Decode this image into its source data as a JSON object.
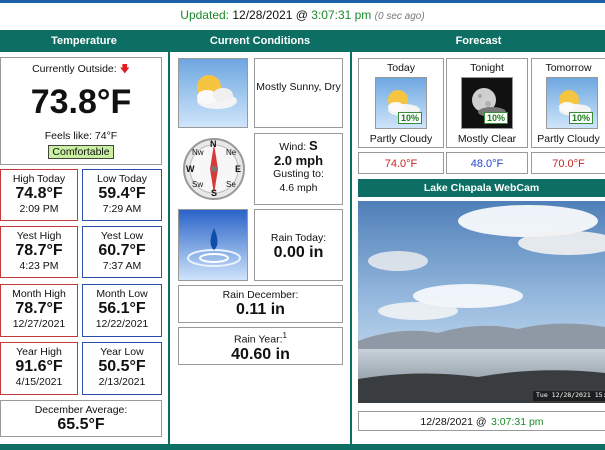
{
  "header": {
    "updated_label": "Updated:",
    "updated_date": "12/28/2021 @",
    "updated_time": "3:07:31 pm",
    "updated_ago": "(0 sec ago)"
  },
  "columns": {
    "temperature": "Temperature",
    "conditions": "Current Conditions",
    "forecast": "Forecast"
  },
  "temperature": {
    "current_label": "Currently Outside:",
    "trend_icon": "down-arrow-icon",
    "current": "73.8°F",
    "feels_like": "Feels like: 74°F",
    "comfort": "Comfortable",
    "high_today_label": "High Today",
    "high_today": "74.8°F",
    "high_today_time": "2:09 PM",
    "low_today_label": "Low Today",
    "low_today": "59.4°F",
    "low_today_time": "7:29 AM",
    "yest_high_label": "Yest High",
    "yest_high": "78.7°F",
    "yest_high_time": "4:23 PM",
    "yest_low_label": "Yest Low",
    "yest_low": "60.7°F",
    "yest_low_time": "7:37 AM",
    "month_high_label": "Month High",
    "month_high": "78.7°F",
    "month_high_date": "12/27/2021",
    "month_low_label": "Month Low",
    "month_low": "56.1°F",
    "month_low_date": "12/22/2021",
    "year_high_label": "Year High",
    "year_high": "91.6°F",
    "year_high_date": "4/15/2021",
    "year_low_label": "Year Low",
    "year_low": "50.5°F",
    "year_low_date": "2/13/2021",
    "dec_avg_label": "December Average:",
    "dec_avg": "65.5°F"
  },
  "conditions": {
    "sky": "Mostly Sunny, Dry",
    "wind_label": "Wind:",
    "wind_dir": "S",
    "wind_speed": "2.0 mph",
    "gust_label": "Gusting to:",
    "gust": "4.6 mph",
    "compass_n": "N",
    "compass_nw": "Nw",
    "compass_ne": "Ne",
    "compass_w": "W",
    "compass_e": "E",
    "compass_sw": "Sw",
    "compass_se": "Se",
    "compass_s": "S",
    "rain_today_label": "Rain Today:",
    "rain_today": "0.00 in",
    "rain_month_label": "Rain December:",
    "rain_month": "0.11 in",
    "rain_year_label": "Rain Year:",
    "rain_year_sup": "1",
    "rain_year": "40.60 in"
  },
  "forecast": {
    "items": [
      {
        "label": "Today",
        "desc": "Partly Cloudy",
        "pct": "10%",
        "temp": "74.0°F",
        "temp_color": "#cc2222"
      },
      {
        "label": "Tonight",
        "desc": "Mostly Clear",
        "pct": "10%",
        "temp": "48.0°F",
        "temp_color": "#2244cc"
      },
      {
        "label": "Tomorrow",
        "desc": "Partly Cloudy",
        "pct": "10%",
        "temp": "70.0°F",
        "temp_color": "#cc2222"
      }
    ],
    "webcam_title": "Lake Chapala WebCam",
    "webcam_date": "12/28/2021 @",
    "webcam_time": "3:07:31 pm",
    "webcam_stamp": "Tue 12/28/2021 15:07"
  },
  "colors": {
    "header_bg": "#0d6f63",
    "updated_green": "#1a8a2a",
    "high_border": "#c43a3a",
    "low_border": "#2a4fa8"
  }
}
